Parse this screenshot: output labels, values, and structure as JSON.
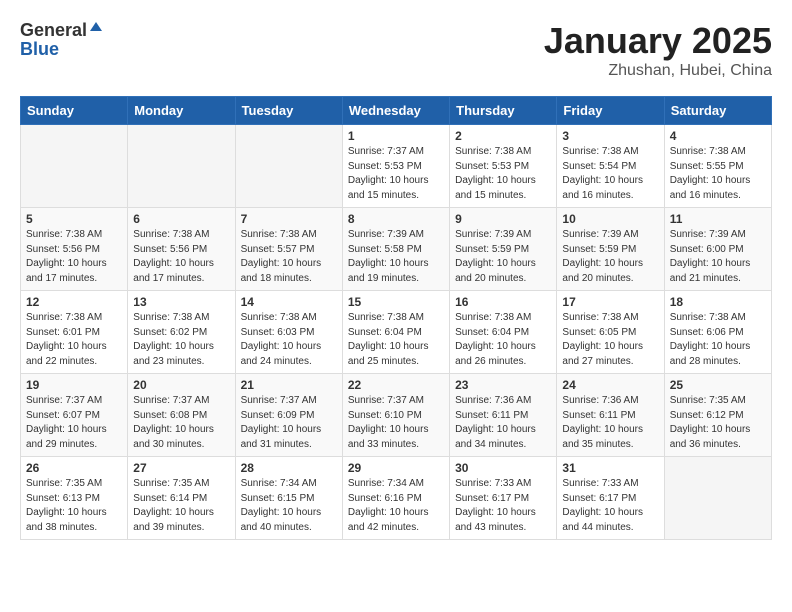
{
  "header": {
    "logo_general": "General",
    "logo_blue": "Blue",
    "title": "January 2025",
    "subtitle": "Zhushan, Hubei, China"
  },
  "weekdays": [
    "Sunday",
    "Monday",
    "Tuesday",
    "Wednesday",
    "Thursday",
    "Friday",
    "Saturday"
  ],
  "weeks": [
    {
      "days": [
        {
          "num": "",
          "info": ""
        },
        {
          "num": "",
          "info": ""
        },
        {
          "num": "",
          "info": ""
        },
        {
          "num": "1",
          "info": "Sunrise: 7:37 AM\nSunset: 5:53 PM\nDaylight: 10 hours\nand 15 minutes."
        },
        {
          "num": "2",
          "info": "Sunrise: 7:38 AM\nSunset: 5:53 PM\nDaylight: 10 hours\nand 15 minutes."
        },
        {
          "num": "3",
          "info": "Sunrise: 7:38 AM\nSunset: 5:54 PM\nDaylight: 10 hours\nand 16 minutes."
        },
        {
          "num": "4",
          "info": "Sunrise: 7:38 AM\nSunset: 5:55 PM\nDaylight: 10 hours\nand 16 minutes."
        }
      ]
    },
    {
      "days": [
        {
          "num": "5",
          "info": "Sunrise: 7:38 AM\nSunset: 5:56 PM\nDaylight: 10 hours\nand 17 minutes."
        },
        {
          "num": "6",
          "info": "Sunrise: 7:38 AM\nSunset: 5:56 PM\nDaylight: 10 hours\nand 17 minutes."
        },
        {
          "num": "7",
          "info": "Sunrise: 7:38 AM\nSunset: 5:57 PM\nDaylight: 10 hours\nand 18 minutes."
        },
        {
          "num": "8",
          "info": "Sunrise: 7:39 AM\nSunset: 5:58 PM\nDaylight: 10 hours\nand 19 minutes."
        },
        {
          "num": "9",
          "info": "Sunrise: 7:39 AM\nSunset: 5:59 PM\nDaylight: 10 hours\nand 20 minutes."
        },
        {
          "num": "10",
          "info": "Sunrise: 7:39 AM\nSunset: 5:59 PM\nDaylight: 10 hours\nand 20 minutes."
        },
        {
          "num": "11",
          "info": "Sunrise: 7:39 AM\nSunset: 6:00 PM\nDaylight: 10 hours\nand 21 minutes."
        }
      ]
    },
    {
      "days": [
        {
          "num": "12",
          "info": "Sunrise: 7:38 AM\nSunset: 6:01 PM\nDaylight: 10 hours\nand 22 minutes."
        },
        {
          "num": "13",
          "info": "Sunrise: 7:38 AM\nSunset: 6:02 PM\nDaylight: 10 hours\nand 23 minutes."
        },
        {
          "num": "14",
          "info": "Sunrise: 7:38 AM\nSunset: 6:03 PM\nDaylight: 10 hours\nand 24 minutes."
        },
        {
          "num": "15",
          "info": "Sunrise: 7:38 AM\nSunset: 6:04 PM\nDaylight: 10 hours\nand 25 minutes."
        },
        {
          "num": "16",
          "info": "Sunrise: 7:38 AM\nSunset: 6:04 PM\nDaylight: 10 hours\nand 26 minutes."
        },
        {
          "num": "17",
          "info": "Sunrise: 7:38 AM\nSunset: 6:05 PM\nDaylight: 10 hours\nand 27 minutes."
        },
        {
          "num": "18",
          "info": "Sunrise: 7:38 AM\nSunset: 6:06 PM\nDaylight: 10 hours\nand 28 minutes."
        }
      ]
    },
    {
      "days": [
        {
          "num": "19",
          "info": "Sunrise: 7:37 AM\nSunset: 6:07 PM\nDaylight: 10 hours\nand 29 minutes."
        },
        {
          "num": "20",
          "info": "Sunrise: 7:37 AM\nSunset: 6:08 PM\nDaylight: 10 hours\nand 30 minutes."
        },
        {
          "num": "21",
          "info": "Sunrise: 7:37 AM\nSunset: 6:09 PM\nDaylight: 10 hours\nand 31 minutes."
        },
        {
          "num": "22",
          "info": "Sunrise: 7:37 AM\nSunset: 6:10 PM\nDaylight: 10 hours\nand 33 minutes."
        },
        {
          "num": "23",
          "info": "Sunrise: 7:36 AM\nSunset: 6:11 PM\nDaylight: 10 hours\nand 34 minutes."
        },
        {
          "num": "24",
          "info": "Sunrise: 7:36 AM\nSunset: 6:11 PM\nDaylight: 10 hours\nand 35 minutes."
        },
        {
          "num": "25",
          "info": "Sunrise: 7:35 AM\nSunset: 6:12 PM\nDaylight: 10 hours\nand 36 minutes."
        }
      ]
    },
    {
      "days": [
        {
          "num": "26",
          "info": "Sunrise: 7:35 AM\nSunset: 6:13 PM\nDaylight: 10 hours\nand 38 minutes."
        },
        {
          "num": "27",
          "info": "Sunrise: 7:35 AM\nSunset: 6:14 PM\nDaylight: 10 hours\nand 39 minutes."
        },
        {
          "num": "28",
          "info": "Sunrise: 7:34 AM\nSunset: 6:15 PM\nDaylight: 10 hours\nand 40 minutes."
        },
        {
          "num": "29",
          "info": "Sunrise: 7:34 AM\nSunset: 6:16 PM\nDaylight: 10 hours\nand 42 minutes."
        },
        {
          "num": "30",
          "info": "Sunrise: 7:33 AM\nSunset: 6:17 PM\nDaylight: 10 hours\nand 43 minutes."
        },
        {
          "num": "31",
          "info": "Sunrise: 7:33 AM\nSunset: 6:17 PM\nDaylight: 10 hours\nand 44 minutes."
        },
        {
          "num": "",
          "info": ""
        }
      ]
    }
  ]
}
